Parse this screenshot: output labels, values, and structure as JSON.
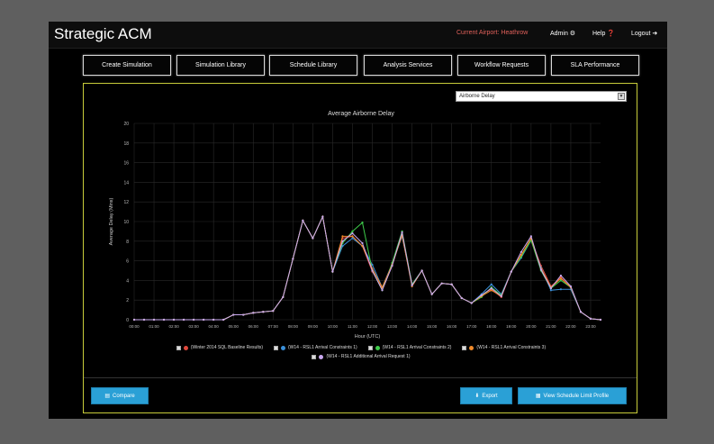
{
  "header": {
    "title": "Strategic ACM",
    "airport": "Current Airport: Heathrow",
    "admin": "Admin",
    "help": "Help",
    "logout": "Logout"
  },
  "nav": {
    "items": [
      "Create Simulation",
      "Simulation Library",
      "Schedule Library",
      "Analysis Services",
      "Workflow Requests",
      "SLA Performance"
    ]
  },
  "metric_select": {
    "value": "Airborne Delay"
  },
  "actions": {
    "compare": "Compare",
    "export": "Export",
    "view_profile": "View Schedule Limit Profile"
  },
  "colors": {
    "accent": "#2aa0d6",
    "panel_border": "#c8cc3a",
    "airport_text": "#e0605a"
  },
  "chart_data": {
    "type": "line",
    "title": "Average Airborne Delay",
    "xlabel": "Hour (UTC)",
    "ylabel": "Average Delay (Mins)",
    "ylim": [
      0,
      20
    ],
    "yticks": [
      0,
      2,
      4,
      6,
      8,
      10,
      12,
      14,
      16,
      18,
      20
    ],
    "grid": true,
    "legend_position": "bottom",
    "x": [
      "00:00",
      "00:30",
      "01:00",
      "01:30",
      "02:00",
      "02:30",
      "03:00",
      "03:30",
      "04:00",
      "04:30",
      "05:00",
      "05:30",
      "06:00",
      "06:30",
      "07:00",
      "07:30",
      "08:00",
      "08:30",
      "09:00",
      "09:30",
      "10:00",
      "10:30",
      "11:00",
      "11:30",
      "12:00",
      "12:30",
      "13:00",
      "13:30",
      "14:00",
      "14:30",
      "15:00",
      "15:30",
      "16:00",
      "16:30",
      "17:00",
      "17:30",
      "18:00",
      "18:30",
      "19:00",
      "19:30",
      "20:00",
      "20:30",
      "21:00",
      "21:30",
      "22:00",
      "22:30",
      "23:00",
      "23:30"
    ],
    "xticks": [
      "00:00",
      "01:00",
      "02:00",
      "03:00",
      "04:00",
      "05:00",
      "06:00",
      "07:00",
      "08:00",
      "09:00",
      "10:00",
      "11:00",
      "12:00",
      "13:00",
      "14:00",
      "15:00",
      "16:00",
      "17:00",
      "18:00",
      "19:00",
      "20:00",
      "21:00",
      "22:00",
      "23:00"
    ],
    "series": [
      {
        "name": "(Winter 2014 SQL Baseline Results)",
        "color": "#e0483c",
        "values": [
          0,
          0,
          0,
          0,
          0,
          0,
          0,
          0,
          0,
          0,
          0.5,
          0.5,
          0.7,
          0.8,
          0.9,
          2.3,
          6.2,
          10.1,
          8.3,
          10.5,
          4.9,
          8.3,
          8.5,
          7.5,
          4.9,
          3.2,
          5.5,
          8.7,
          3.6,
          5.0,
          2.6,
          3.7,
          3.6,
          2.2,
          1.7,
          2.5,
          3.1,
          2.3,
          4.9,
          6.5,
          8.2,
          5.5,
          3.4,
          4.3,
          3.3,
          0.8,
          0.1,
          0
        ]
      },
      {
        "name": "(W14 - RSL1 Arrival Constraints 1)",
        "color": "#3a8fd9",
        "values": [
          0,
          0,
          0,
          0,
          0,
          0,
          0,
          0,
          0,
          0,
          0.5,
          0.5,
          0.7,
          0.8,
          0.9,
          2.3,
          6.2,
          10.1,
          8.3,
          10.5,
          4.9,
          7.5,
          8.3,
          7.5,
          5.6,
          3.3,
          5.7,
          8.5,
          3.6,
          5.0,
          2.6,
          3.7,
          3.6,
          2.2,
          1.7,
          2.6,
          3.6,
          2.6,
          4.9,
          6.3,
          8.1,
          5.3,
          3.0,
          3.1,
          3.1,
          0.8,
          0.1,
          0
        ]
      },
      {
        "name": "(W14 - RSL1 Arrival Constraints 2)",
        "color": "#3ecb4a",
        "values": [
          0,
          0,
          0,
          0,
          0,
          0,
          0,
          0,
          0,
          0,
          0.5,
          0.5,
          0.7,
          0.8,
          0.9,
          2.3,
          6.2,
          10.1,
          8.3,
          10.5,
          4.9,
          7.8,
          9.0,
          9.9,
          5.0,
          3.0,
          5.8,
          9.0,
          3.6,
          5.0,
          2.6,
          3.7,
          3.6,
          2.2,
          1.7,
          2.3,
          3.3,
          2.5,
          4.9,
          6.4,
          8.1,
          5.0,
          3.2,
          4.0,
          3.3,
          0.8,
          0.1,
          0
        ]
      },
      {
        "name": "(W14 - RSL1 Arrival Constraints 3)",
        "color": "#f08a2a",
        "values": [
          0,
          0,
          0,
          0,
          0,
          0,
          0,
          0,
          0,
          0,
          0.5,
          0.5,
          0.7,
          0.8,
          0.9,
          2.3,
          6.2,
          10.1,
          8.3,
          10.5,
          4.9,
          8.5,
          8.5,
          7.5,
          5.2,
          3.3,
          5.6,
          8.6,
          3.4,
          5.0,
          2.6,
          3.7,
          3.6,
          2.2,
          1.7,
          2.4,
          3.0,
          2.4,
          4.9,
          6.6,
          8.3,
          5.2,
          3.3,
          4.2,
          3.3,
          0.8,
          0.1,
          0
        ]
      },
      {
        "name": "(W14 - RSL1 Additional Arrival Request 1)",
        "color": "#c9a8ef",
        "values": [
          0,
          0,
          0,
          0,
          0,
          0,
          0,
          0,
          0,
          0,
          0.5,
          0.5,
          0.7,
          0.8,
          0.9,
          2.3,
          6.2,
          10.1,
          8.3,
          10.5,
          4.9,
          8.0,
          8.8,
          7.8,
          5.0,
          3.0,
          5.5,
          8.9,
          3.5,
          5.0,
          2.6,
          3.7,
          3.6,
          2.2,
          1.7,
          2.5,
          3.2,
          2.4,
          4.9,
          6.9,
          8.5,
          5.1,
          3.2,
          4.5,
          3.4,
          0.8,
          0.1,
          0
        ]
      }
    ]
  }
}
